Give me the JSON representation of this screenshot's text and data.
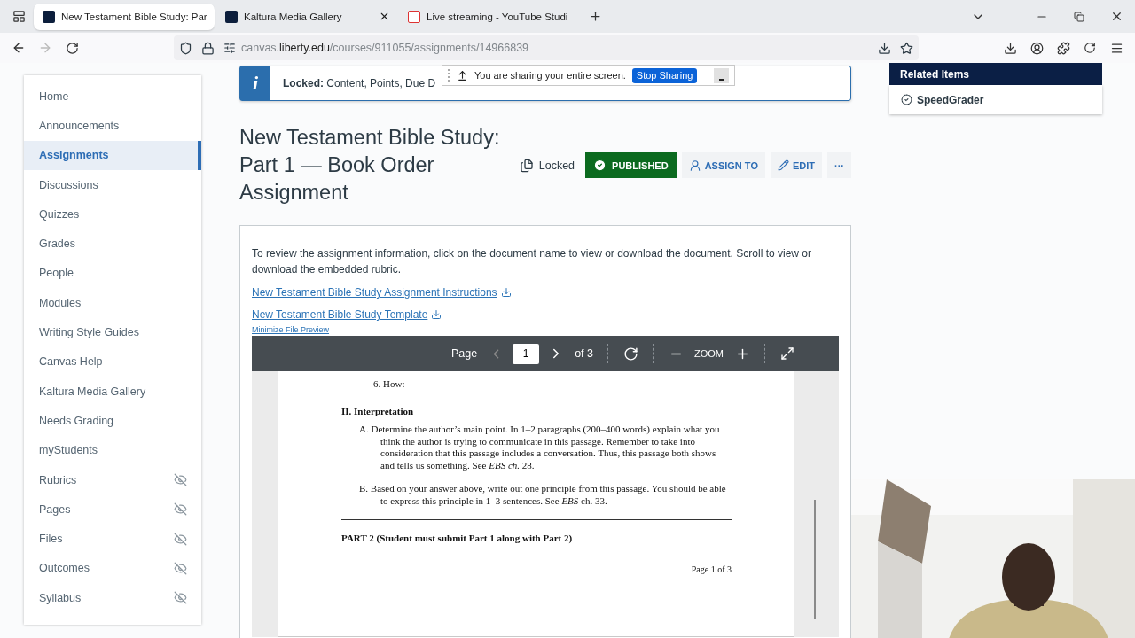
{
  "browser": {
    "tabs": [
      {
        "title": "New Testament Bible Study: Par",
        "kind": "course",
        "selected": true
      },
      {
        "title": "Kaltura Media Gallery",
        "kind": "course",
        "selected": false
      },
      {
        "title": "Live streaming - YouTube Studi",
        "kind": "studio",
        "selected": false
      }
    ],
    "url": [
      {
        "text": "canvas.",
        "emphasis": false
      },
      {
        "text": "liberty.edu",
        "emphasis": true
      },
      {
        "text": "/courses/911055/assignments/14966839",
        "emphasis": false
      }
    ]
  },
  "screen_share": {
    "message": "You are sharing your entire screen.",
    "button": "Stop Sharing"
  },
  "sidebar": {
    "items": [
      {
        "label": "Home",
        "selected": false,
        "hidden": false
      },
      {
        "label": "Announcements",
        "selected": false,
        "hidden": false
      },
      {
        "label": "Assignments",
        "selected": true,
        "hidden": false
      },
      {
        "label": "Discussions",
        "selected": false,
        "hidden": false
      },
      {
        "label": "Quizzes",
        "selected": false,
        "hidden": false
      },
      {
        "label": "Grades",
        "selected": false,
        "hidden": false
      },
      {
        "label": "People",
        "selected": false,
        "hidden": false
      },
      {
        "label": "Modules",
        "selected": false,
        "hidden": false
      },
      {
        "label": "Writing Style Guides",
        "selected": false,
        "hidden": false
      },
      {
        "label": "Canvas Help",
        "selected": false,
        "hidden": false
      },
      {
        "label": "Kaltura Media Gallery",
        "selected": false,
        "hidden": false
      },
      {
        "label": "Needs Grading",
        "selected": false,
        "hidden": false
      },
      {
        "label": "myStudents",
        "selected": false,
        "hidden": false
      },
      {
        "label": "Rubrics",
        "selected": false,
        "hidden": true
      },
      {
        "label": "Pages",
        "selected": false,
        "hidden": true
      },
      {
        "label": "Files",
        "selected": false,
        "hidden": true
      },
      {
        "label": "Outcomes",
        "selected": false,
        "hidden": true
      },
      {
        "label": "Syllabus",
        "selected": false,
        "hidden": true
      }
    ]
  },
  "banner": {
    "icon": "i",
    "label": "Locked:",
    "text": "Content, Points, Due D"
  },
  "assignment": {
    "title": "New Testament Bible Study: Part 1 — Book Order Assignment",
    "lock_label": "Locked",
    "published_label": "PUBLISHED",
    "published": true,
    "assign_button": "ASSIGN TO",
    "edit_button": "EDIT",
    "more_button": "···",
    "intro": "To review the assignment information, click on the document name to view or download the document. Scroll to view or download the embedded rubric.",
    "files": [
      "New Testament Bible Study Assignment Instructions",
      "New Testament Bible Study Template"
    ],
    "minimize_link": "Minimize File Preview"
  },
  "viewer": {
    "page_label": "Page",
    "page": "1",
    "of_label": "of 3",
    "zoom_label": "ZOOM",
    "document": [
      {
        "kind": "item",
        "text": "6. How:"
      },
      {
        "kind": "heading",
        "text": "II. Interpretation"
      },
      {
        "kind": "para",
        "text": "A. Determine the author’s main point. In 1–2 paragraphs (200–400 words) explain what you think the author is trying to communicate in this passage. Remember to take into consideration that this passage includes a conversation. Thus, this passage both shows and tells us something. See *EBS ch.* 28."
      },
      {
        "kind": "para",
        "text": "B. Based on your answer above, write out one principle from this passage. You should be able to express this principle in 1–3 sentences. See *EBS* ch. 33."
      },
      {
        "kind": "rule"
      },
      {
        "kind": "heading",
        "text": "PART 2 (Student must submit Part 1 along with Part 2)"
      },
      {
        "kind": "footer",
        "text": "Page 1 of 3"
      }
    ]
  },
  "related": {
    "title": "Related Items",
    "items": [
      "SpeedGrader"
    ]
  }
}
